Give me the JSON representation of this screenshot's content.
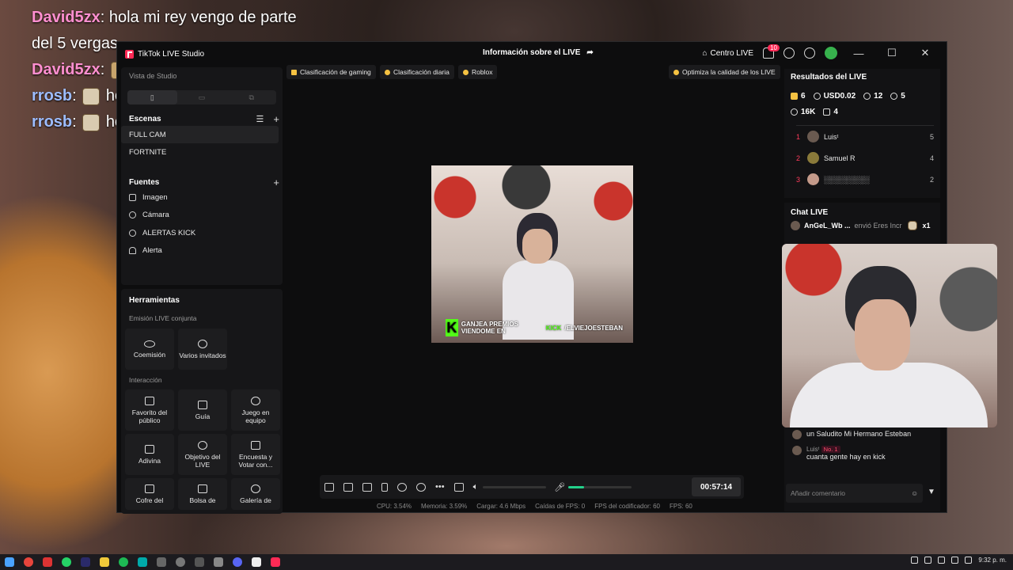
{
  "overlay_chat": [
    {
      "user": "David5zx",
      "message": "hola mi rey vengo de parte"
    },
    {
      "user": "",
      "message": "del 5 vergas"
    },
    {
      "user": "David5zx",
      "message": ""
    },
    {
      "user": "rrosb",
      "message": "hola"
    },
    {
      "user": "rrosb",
      "message": "hola"
    }
  ],
  "app": {
    "title": "TikTok LIVE Studio",
    "center_title": "Información sobre el LIVE",
    "live_center": "Centro LIVE",
    "notification_count": "10"
  },
  "left": {
    "studio_view_label": "Vista de Studio",
    "scenes_title": "Escenas",
    "scenes": [
      "FULL CAM",
      "FORTNITE"
    ],
    "sources_title": "Fuentes",
    "sources": [
      "Imagen",
      "Cámara",
      "ALERTAS KICK",
      "Alerta"
    ],
    "tools_title": "Herramientas",
    "joint_live_label": "Emisión LIVE conjunta",
    "joint_live_tools": [
      "Coemisión",
      "Varios invitados"
    ],
    "interaction_label": "Interacción",
    "interaction_tools": [
      "Favorito del público",
      "Guía",
      "Juego en equipo",
      "Adivina",
      "Objetivo del LIVE",
      "Encuesta y Votar con...",
      "Cofre del",
      "Bolsa de",
      "Galería de"
    ]
  },
  "center": {
    "pills": [
      "Clasificación de gaming",
      "Clasificación diaria",
      "Roblox"
    ],
    "optimize": "Optimiza la calidad de los LIVE",
    "banner_text_a": "GANJEA PREMIOS VIENDOME EN",
    "banner_kick": "KICK",
    "banner_text_b": "/ELVIEJOESTEBAN",
    "timer": "00:57:14",
    "mic_level": 0.25,
    "stats": {
      "cpu": "CPU: 3.54%",
      "memory": "Memoria: 3.59%",
      "upload": "Cargar: 4.6 Mbps",
      "fps_drops": "Caídas de FPS: 0",
      "encoder_fps": "FPS del codificador: 60",
      "fps": "FPS: 60"
    }
  },
  "right": {
    "results_title": "Resultados del LIVE",
    "stat_diamonds": "6",
    "stat_usd": "USD0.02",
    "stat_viewers": "12",
    "stat_new": "5",
    "stat_likes": "16K",
    "stat_gifts": "4",
    "ranking": [
      {
        "rank": "1",
        "name": "Luisᵗ",
        "value": "5"
      },
      {
        "rank": "2",
        "name": "Samuel R",
        "value": "4"
      },
      {
        "rank": "3",
        "name": "░░░░░░░░░",
        "value": "2"
      }
    ],
    "chat_title": "Chat LIVE",
    "chat_top": {
      "user": "AnGeL_Wb ...",
      "text": "envió Eres Incr",
      "count": "x1"
    },
    "chat_messages": [
      {
        "user": "",
        "text": "un Saludito Mi Hermano Esteban"
      },
      {
        "user": "Luisᵗ",
        "badge": "No. 1",
        "text": "cuanta gente hay en kick"
      }
    ],
    "comment_placeholder": "Añadir comentario"
  },
  "taskbar": {
    "clock": "9:32 p. m."
  }
}
